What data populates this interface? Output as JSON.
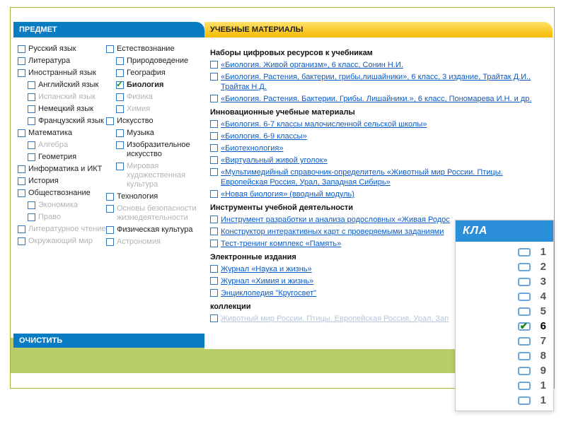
{
  "headers": {
    "subject": "ПРЕДМЕТ",
    "materials": "УЧЕБНЫЕ МАТЕРИАЛЫ",
    "clear": "ОЧИСТИТЬ",
    "class": "КЛА"
  },
  "subjects_col1": [
    {
      "label": "Русский язык",
      "checked": false,
      "disabled": false,
      "indent": 0
    },
    {
      "label": "Литература",
      "checked": false,
      "disabled": false,
      "indent": 0
    },
    {
      "label": "Иностранный язык",
      "checked": false,
      "disabled": false,
      "indent": 0
    },
    {
      "label": "Английский язык",
      "checked": false,
      "disabled": false,
      "indent": 1
    },
    {
      "label": "Испанский язык",
      "checked": false,
      "disabled": true,
      "indent": 1
    },
    {
      "label": "Немецкий язык",
      "checked": false,
      "disabled": false,
      "indent": 1
    },
    {
      "label": "Французский язык",
      "checked": false,
      "disabled": false,
      "indent": 1
    },
    {
      "label": "Математика",
      "checked": false,
      "disabled": false,
      "indent": 0
    },
    {
      "label": "Алгебра",
      "checked": false,
      "disabled": true,
      "indent": 1
    },
    {
      "label": "Геометрия",
      "checked": false,
      "disabled": false,
      "indent": 1
    },
    {
      "label": "Информатика и ИКТ",
      "checked": false,
      "disabled": false,
      "indent": 0
    },
    {
      "label": "История",
      "checked": false,
      "disabled": false,
      "indent": 0
    },
    {
      "label": "Обществознание",
      "checked": false,
      "disabled": false,
      "indent": 0
    },
    {
      "label": "Экономика",
      "checked": false,
      "disabled": true,
      "indent": 1
    },
    {
      "label": "Право",
      "checked": false,
      "disabled": true,
      "indent": 1
    },
    {
      "label": "Литературное чтение",
      "checked": false,
      "disabled": true,
      "indent": 0
    },
    {
      "label": "Окружающий мир",
      "checked": false,
      "disabled": true,
      "indent": 0
    }
  ],
  "subjects_col2": [
    {
      "label": "Естествознание",
      "checked": false,
      "disabled": false,
      "indent": 0
    },
    {
      "label": "Природоведение",
      "checked": false,
      "disabled": false,
      "indent": 1
    },
    {
      "label": "География",
      "checked": false,
      "disabled": false,
      "indent": 1
    },
    {
      "label": "Биология",
      "checked": true,
      "disabled": false,
      "indent": 1,
      "bold": true
    },
    {
      "label": "Физика",
      "checked": false,
      "disabled": true,
      "indent": 1
    },
    {
      "label": "Химия",
      "checked": false,
      "disabled": true,
      "indent": 1
    },
    {
      "label": "Искусство",
      "checked": false,
      "disabled": false,
      "indent": 0
    },
    {
      "label": "Музыка",
      "checked": false,
      "disabled": false,
      "indent": 1
    },
    {
      "label": "Изобразительное искусство",
      "checked": false,
      "disabled": false,
      "indent": 1
    },
    {
      "label": "Мировая художественная культура",
      "checked": false,
      "disabled": true,
      "indent": 1
    },
    {
      "label": "Технология",
      "checked": false,
      "disabled": false,
      "indent": 0
    },
    {
      "label": "Основы безопасности жизнедеятельности",
      "checked": false,
      "disabled": true,
      "indent": 0
    },
    {
      "label": "Физическая культура",
      "checked": false,
      "disabled": false,
      "indent": 0
    },
    {
      "label": "Астрономия",
      "checked": false,
      "disabled": true,
      "indent": 0
    }
  ],
  "sections": [
    {
      "title": "Наборы цифровых ресурсов к учебникам",
      "links": [
        "«Биология. Живой организм», 6 класс, Сонин Н.И.",
        "«Биология. Растения, бактерии, грибы,лишайники», 6 класс, 3 издание, Трайтак Д.И., Трайтак Н.Д.",
        "«Биология. Растения. Бактерии. Грибы. Лишайники.», 6 класс, Пономарева И.Н. и др."
      ]
    },
    {
      "title": "Инновационные учебные материалы",
      "links": [
        "«Биология. 6-7 классы малочисленной сельской школы»",
        "«Биология. 6-9 классы»",
        "«Биотехнология»",
        "«Виртуальный живой уголок»",
        "«Мультимедийный справочник-определитель «Животный мир России. Птицы. Европейская Россия, Урал, Западная Сибирь»",
        "«Новая биология» (вводный модуль)"
      ]
    },
    {
      "title": "Инструменты учебной деятельности",
      "links": [
        "Инструмент разработки и анализа родословных «Живая Родос",
        "Конструктор интерактивных карт с проверяемыми заданиями",
        "Тест-тренинг комплекс «Память»"
      ]
    },
    {
      "title": "Электронные издания",
      "links": [
        "Журнал «Наука и жизнь»",
        "Журнал «Химия и жизнь»",
        "Энциклопедия \"Кругосвет\""
      ]
    },
    {
      "title": "коллекции",
      "links": [
        "Животный мир России. Птицы. Европейская Россия, Урал, Зап"
      ],
      "faded": true
    }
  ],
  "class_rows": [
    {
      "n": "1",
      "checked": false
    },
    {
      "n": "2",
      "checked": false
    },
    {
      "n": "3",
      "checked": false
    },
    {
      "n": "4",
      "checked": false
    },
    {
      "n": "5",
      "checked": false
    },
    {
      "n": "6",
      "checked": true,
      "highlight": true
    },
    {
      "n": "7",
      "checked": false
    },
    {
      "n": "8",
      "checked": false
    },
    {
      "n": "9",
      "checked": false
    },
    {
      "n": "1",
      "checked": false
    },
    {
      "n": "1",
      "checked": false
    }
  ]
}
